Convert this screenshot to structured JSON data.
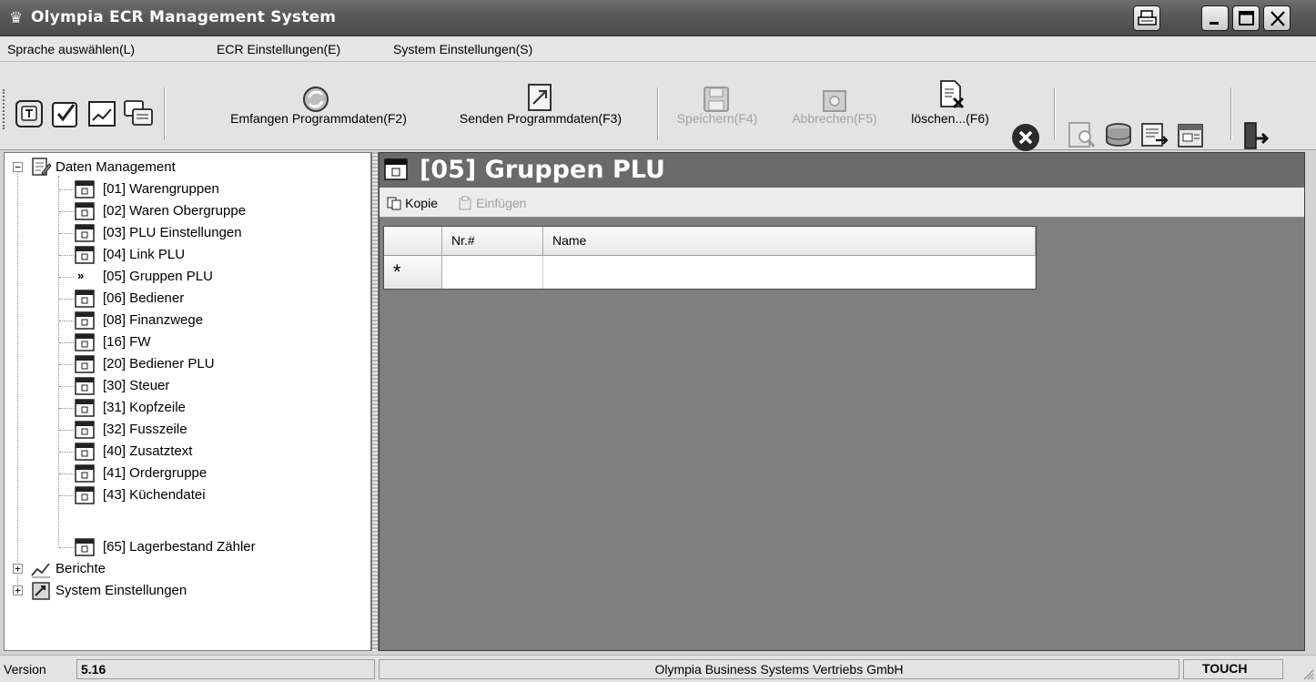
{
  "window": {
    "title": "Olympia ECR Management System"
  },
  "menubar": {
    "items": [
      {
        "label": "Sprache auswählen(L)"
      },
      {
        "label": "ECR Einstellungen(E)"
      },
      {
        "label": "System Einstellungen(S)"
      }
    ]
  },
  "toolbar": {
    "receive_label": "Emfangen Programmdaten(F2)",
    "send_label": "Senden Programmdaten(F3)",
    "save_label": "Speichern(F4)",
    "cancel_label": "Abbrechen(F5)",
    "delete_label": "löschen...(F6)"
  },
  "tree": {
    "root_label": "Daten Management",
    "items": [
      {
        "label": "[01] Warengruppen"
      },
      {
        "label": "[02] Waren Obergruppe"
      },
      {
        "label": "[03] PLU Einstellungen"
      },
      {
        "label": "[04] Link PLU"
      },
      {
        "label": "[05] Gruppen PLU",
        "current": true,
        "marker": "»"
      },
      {
        "label": "[06] Bediener"
      },
      {
        "label": "[08] Finanzwege"
      },
      {
        "label": "[16] FW"
      },
      {
        "label": "[20] Bediener PLU"
      },
      {
        "label": "[30] Steuer"
      },
      {
        "label": "[31] Kopfzeile"
      },
      {
        "label": "[32] Fusszeile"
      },
      {
        "label": "[40] Zusatztext"
      },
      {
        "label": "[41] Ordergruppe"
      },
      {
        "label": "[43] Küchendatei"
      },
      {
        "label": "[65] Lagerbestand Zähler"
      }
    ],
    "other_roots": [
      {
        "label": "Berichte"
      },
      {
        "label": "System Einstellungen"
      }
    ]
  },
  "panel": {
    "title": "[05] Gruppen PLU",
    "copy_label": "Kopie",
    "paste_label": "Einfügen",
    "grid": {
      "columns": [
        "Nr.#",
        "Name"
      ],
      "new_row_marker": "*"
    }
  },
  "statusbar": {
    "version_label": "Version",
    "version": "5.16",
    "company": "Olympia Business Systems Vertriebs GmbH",
    "mode": "TOUCH"
  }
}
